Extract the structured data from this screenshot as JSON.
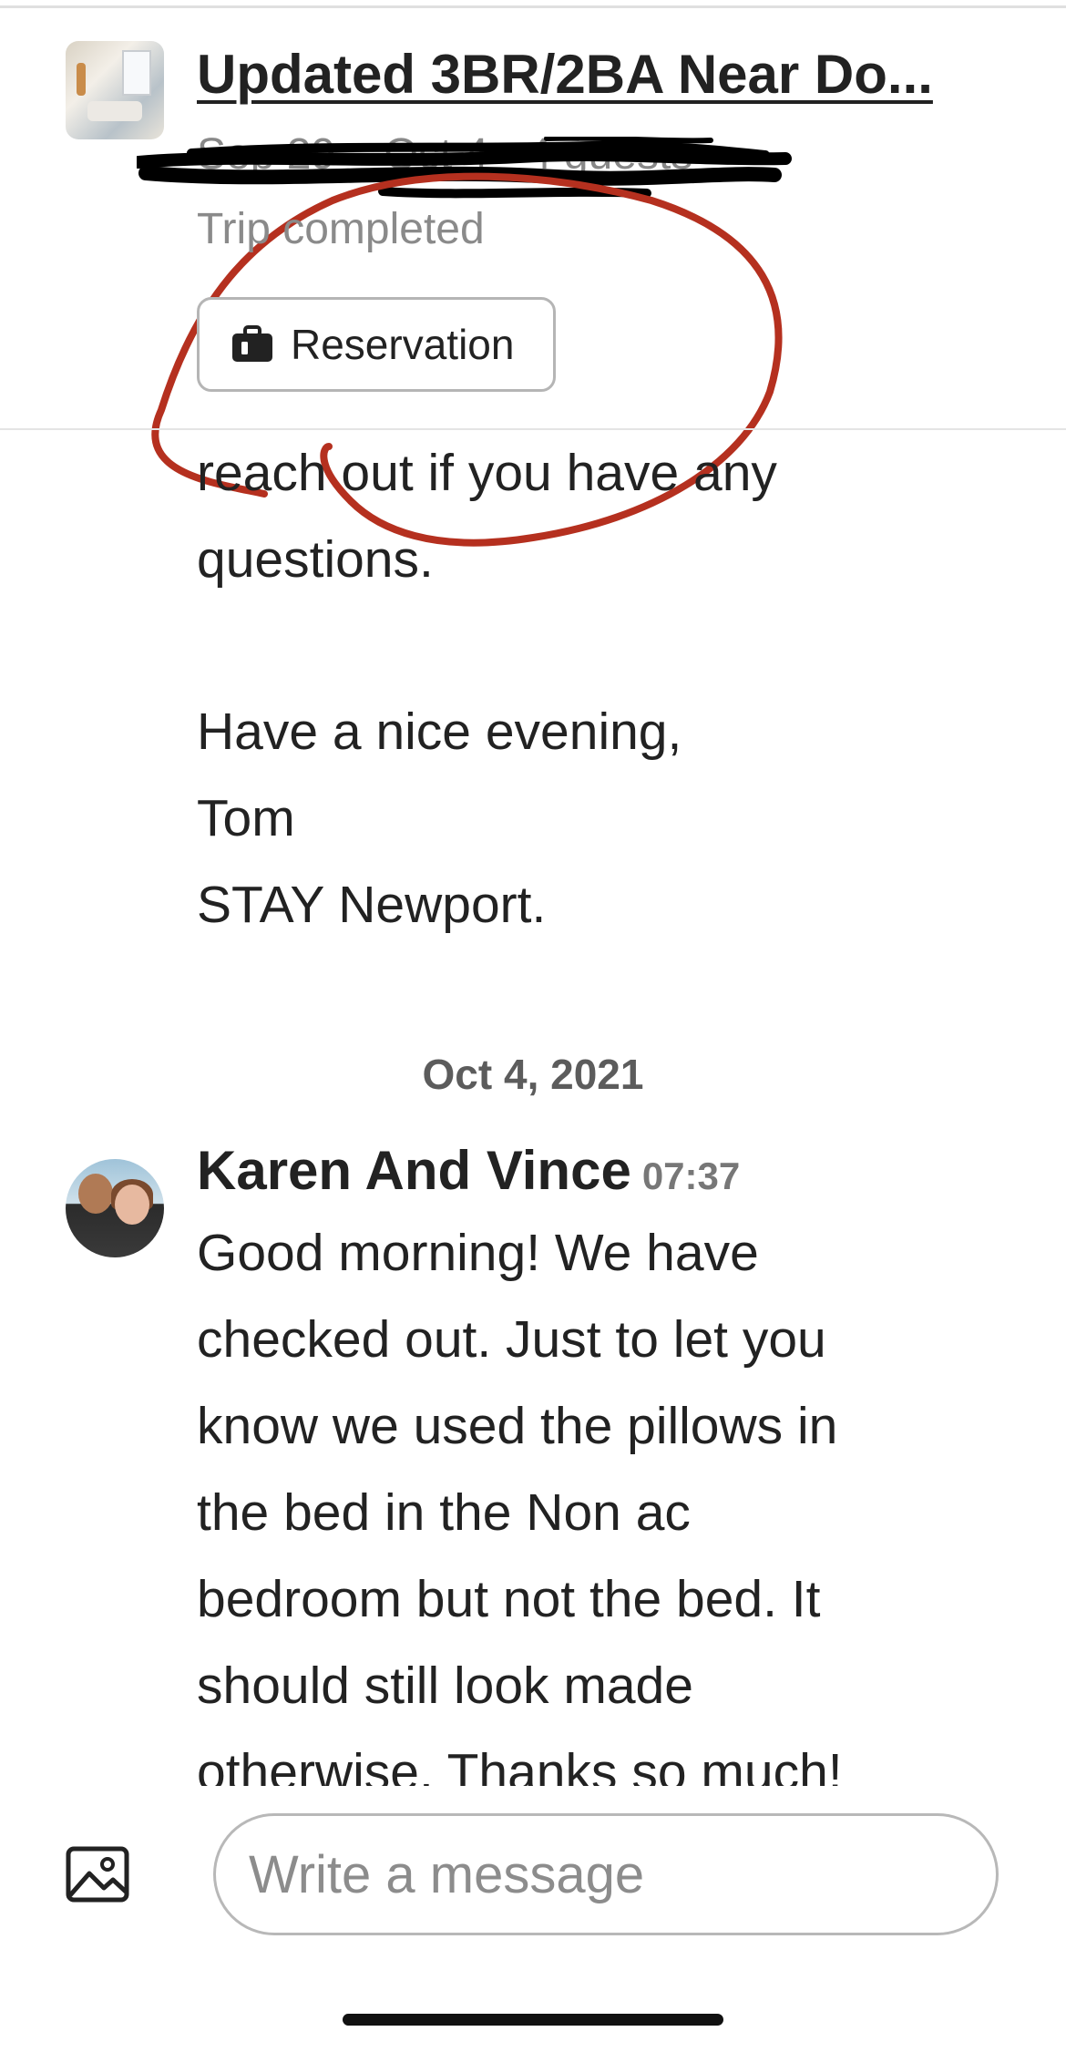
{
  "header": {
    "listing_title": "Updated 3BR/2BA Near Do...",
    "trip_dates": "Sep 29 – Oct 4 · 4 guests",
    "trip_status": "Trip completed",
    "reservation_button_label": "Reservation",
    "thumbnail_icon": "listing-photo"
  },
  "annotation": {
    "color": "#b5301f"
  },
  "thread": {
    "previous_message_tail": "reach out if you have any\nquestions.",
    "previous_message_signoff": "Have a nice evening,\nTom\nSTAY Newport.",
    "date_separator": "Oct 4, 2021",
    "message": {
      "sender": "Karen And Vince",
      "time": "07:37",
      "text": "Good morning!  We have\nchecked out. Just to let you\nknow we used the pillows in\nthe bed in the Non ac\nbedroom but not the bed. It\nshould still look made\notherwise. Thanks so much!"
    }
  },
  "composer": {
    "placeholder": "Write a message",
    "value": "",
    "photo_icon": "image-icon"
  }
}
